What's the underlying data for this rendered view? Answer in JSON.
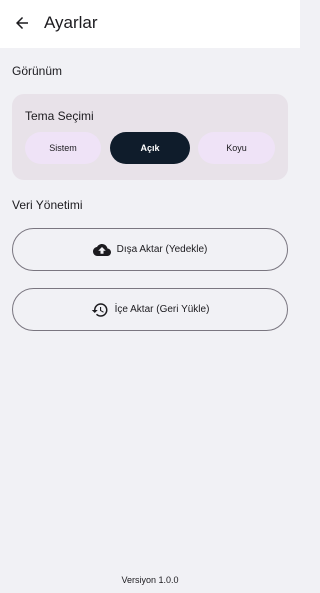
{
  "header": {
    "title": "Ayarlar",
    "back_icon": "arrow-back-icon"
  },
  "appearance": {
    "section_title": "Görünüm",
    "card_title": "Tema Seçimi",
    "options": [
      {
        "label": "Sistem",
        "selected": false
      },
      {
        "label": "Açık",
        "selected": true
      },
      {
        "label": "Koyu",
        "selected": false
      }
    ]
  },
  "data_management": {
    "section_title": "Veri Yönetimi",
    "export_label": "Dışa Aktar (Yedekle)",
    "export_icon": "cloud-upload-icon",
    "import_label": "İçe Aktar (Geri Yükle)",
    "import_icon": "restore-history-icon"
  },
  "footer": {
    "version": "Versiyon 1.0.0"
  },
  "colors": {
    "background": "#f1f1f5",
    "card": "#e8e2e9",
    "chip": "#efe3f7",
    "selected_chip": "#0f1c2b"
  }
}
